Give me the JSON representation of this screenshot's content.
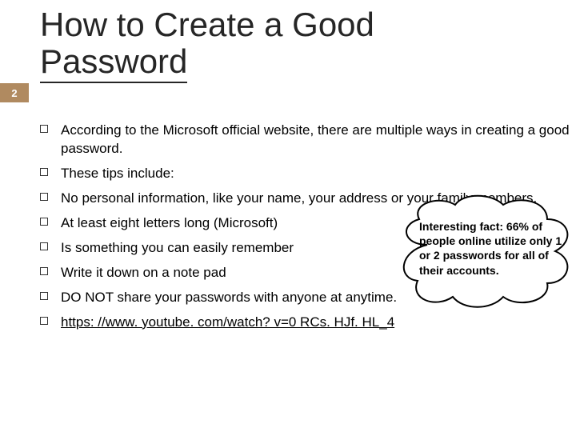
{
  "slide_number": "2",
  "title_line1": "How to Create a Good",
  "title_line2": "Password",
  "bullets": [
    "According to the Microsoft official website, there are multiple ways in creating a good password.",
    "These tips include:",
    "No personal information, like your name, your address or your family members.",
    "At least eight letters long (Microsoft)",
    "Is something you can easily remember",
    "Write it down on a note pad",
    "DO NOT share your passwords with anyone at anytime.",
    "https: //www. youtube. com/watch? v=0 RCs. HJf. HL_4"
  ],
  "callout": {
    "text": "Interesting fact: 66% of people online utilize only 1 or 2 passwords for all of their accounts."
  }
}
